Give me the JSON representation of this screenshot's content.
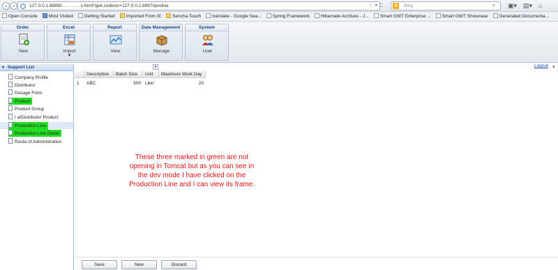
{
  "browser": {
    "url": "127.0.0.1:8889/l...  . .  . . .  .s.html?gwt.codesvr=127.0.0.1:9997#proline",
    "search_placeholder": "Bing",
    "bookmarks": [
      {
        "label": "Open Console",
        "icon": "page-icon"
      },
      {
        "label": "Most Visited",
        "icon": "star-icon"
      },
      {
        "label": "Getting Started",
        "icon": "page-icon"
      },
      {
        "label": "Imported From IE",
        "icon": "folder-icon"
      },
      {
        "label": "Sencha Touch",
        "icon": "folder-icon"
      },
      {
        "label": "translate - Google Sea...",
        "icon": "page-icon"
      },
      {
        "label": "Spring Framework",
        "icon": "page-icon"
      },
      {
        "label": "Hibernate Archives - J...",
        "icon": "page-icon"
      },
      {
        "label": "Smart GWT Enterprise ...",
        "icon": "page-icon"
      },
      {
        "label": "Smart GWT Showcase",
        "icon": "page-icon"
      },
      {
        "label": "Generated Documenta...",
        "icon": "page-icon"
      }
    ]
  },
  "toolbar": {
    "groups": [
      {
        "title": "Order",
        "tool": "New",
        "icon": "new-order-icon"
      },
      {
        "title": "Excel",
        "tool": "Import",
        "icon": "excel-import-icon"
      },
      {
        "title": "Report",
        "tool": "View",
        "icon": "report-view-icon"
      },
      {
        "title": "Data Management",
        "tool": "Manage",
        "icon": "manage-box-icon"
      },
      {
        "title": "System",
        "tool": "User",
        "icon": "users-icon"
      }
    ],
    "logout_label": "Logout"
  },
  "sidebar": {
    "title": "Support List",
    "items": [
      {
        "label": "Company Profile",
        "highlight": false
      },
      {
        "label": "Distributor",
        "highlight": false
      },
      {
        "label": "Dosage Form",
        "highlight": false
      },
      {
        "label": "Product",
        "highlight": true
      },
      {
        "label": "Product Group",
        "highlight": false
      },
      {
        "label": "I        a/Distributor Product",
        "highlight": false
      },
      {
        "label": "Production Line",
        "highlight": true
      },
      {
        "label": "Production Line Detail",
        "highlight": true
      },
      {
        "label": "Route of Administration",
        "highlight": false
      }
    ]
  },
  "grid": {
    "columns": [
      "Description",
      "Batch Size",
      "Unit",
      "Maximum Work Day"
    ],
    "rows": [
      {
        "row_num": "1",
        "description": "ABC",
        "batch_size": "500",
        "unit": "Liter",
        "max_work_day": "20"
      }
    ]
  },
  "annotation": "These three marked in green are not opening in Tomcat but as you can see in the dev mode I have clicked on the Production Line and I can view its frame.",
  "buttons": {
    "save": "Save",
    "new": "New",
    "discard": "Discard"
  },
  "colors": {
    "highlight": "#22dd22",
    "annotation": "#e21212",
    "header_blue": "#15428b"
  }
}
